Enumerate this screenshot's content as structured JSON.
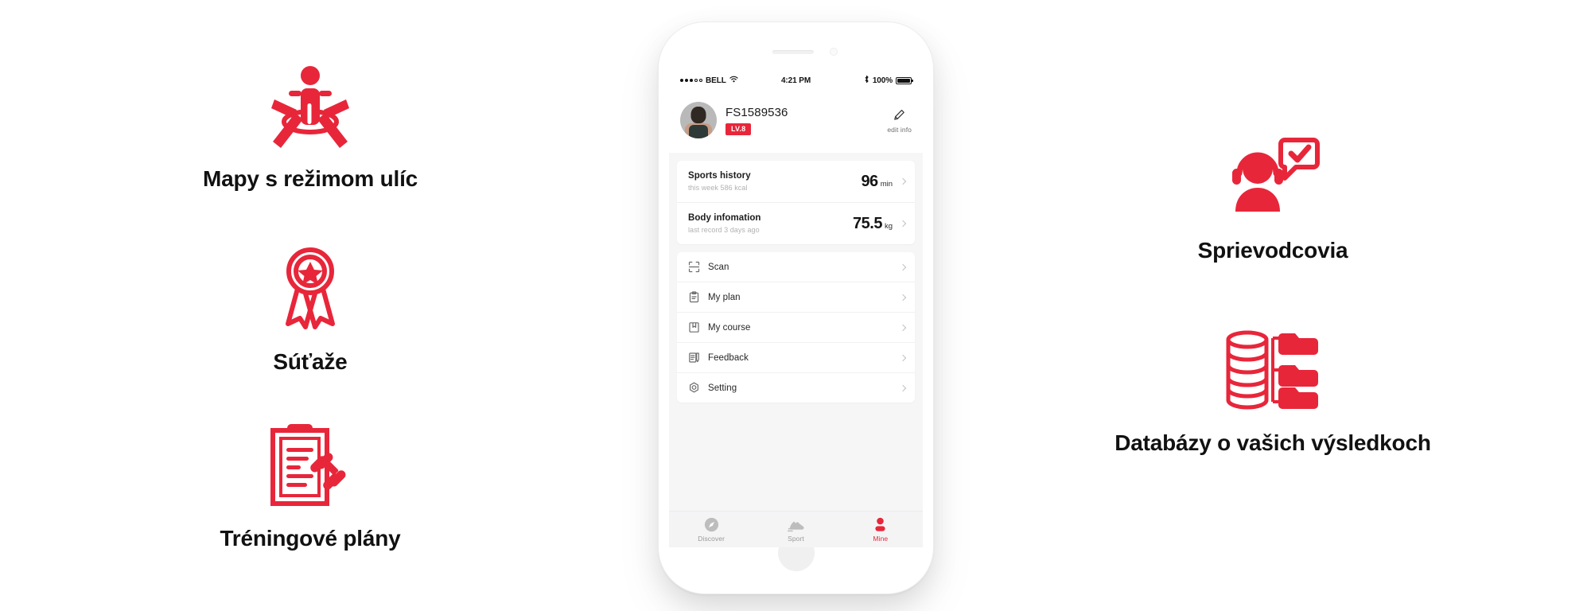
{
  "brand": {
    "red": "#e8263a",
    "text_dark": "#111111"
  },
  "features": {
    "left": [
      {
        "icon": "street-map-person-icon",
        "label": "Mapy s režimom ulíc"
      },
      {
        "icon": "award-ribbon-icon",
        "label": "Súťaže"
      },
      {
        "icon": "clipboard-dumbbell-icon",
        "label": "Tréningové plány"
      }
    ],
    "right": [
      {
        "icon": "support-headset-icon",
        "label": "Sprievodcovia"
      },
      {
        "icon": "database-folders-icon",
        "label": "Databázy o vašich výsledkoch"
      }
    ]
  },
  "phone": {
    "status_bar": {
      "carrier": "BELL",
      "signal_dots_filled": 3,
      "signal_dots_total": 5,
      "wifi_icon": "wifi-icon",
      "time": "4:21 PM",
      "bluetooth_icon": "bluetooth-icon",
      "battery_percent": "100%"
    },
    "profile": {
      "avatar_icon": "user-avatar",
      "username": "FS1589536",
      "level_badge": "LV.8",
      "edit_icon": "pencil-icon",
      "edit_label": "edit info"
    },
    "stats": [
      {
        "icon": "sports-history-row",
        "title": "Sports history",
        "subtitle": "this week 586 kcal",
        "value": "96",
        "unit": "min",
        "chevron": "chevron-right-icon"
      },
      {
        "icon": "body-information-row",
        "title": "Body infomation",
        "subtitle": "last record 3 days ago",
        "value": "75.5",
        "unit": "kg",
        "chevron": "chevron-right-icon"
      }
    ],
    "menu": [
      {
        "icon": "scan-icon",
        "label": "Scan",
        "chevron": "chevron-right-icon"
      },
      {
        "icon": "clipboard-icon",
        "label": "My plan",
        "chevron": "chevron-right-icon"
      },
      {
        "icon": "book-icon",
        "label": "My course",
        "chevron": "chevron-right-icon"
      },
      {
        "icon": "feedback-icon",
        "label": "Feedback",
        "chevron": "chevron-right-icon"
      },
      {
        "icon": "settings-gear-icon",
        "label": "Setting",
        "chevron": "chevron-right-icon"
      }
    ],
    "tabs": [
      {
        "icon": "compass-icon",
        "label": "Discover",
        "active": false
      },
      {
        "icon": "shoe-icon",
        "label": "Sport",
        "active": false
      },
      {
        "icon": "person-icon",
        "label": "Mine",
        "active": true
      }
    ]
  }
}
